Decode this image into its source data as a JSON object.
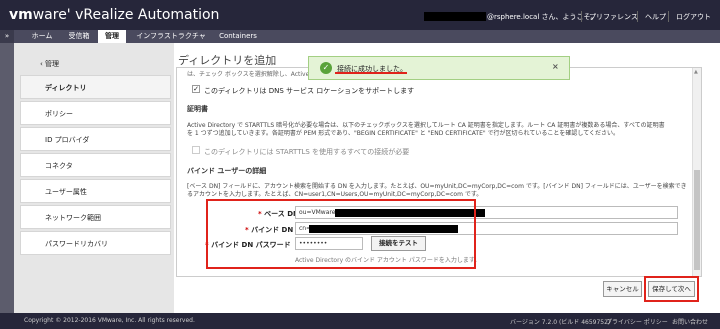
{
  "header": {
    "logo_brand": "vm",
    "logo_rest": "ware' vRealize Automation",
    "user_suffix": "@rsphere.local さん、ようこそ。",
    "links": {
      "preferences": "プリファレンス",
      "help": "ヘルプ",
      "logout": "ログアウト"
    }
  },
  "nav": {
    "toggle": "»",
    "tabs": [
      "ホーム",
      "受信箱",
      "管理",
      "インフラストラクチャ",
      "Containers"
    ]
  },
  "sidebar": {
    "back": "‹ 管理",
    "items": [
      "ディレクトリ",
      "ポリシー",
      "ID プロバイダ",
      "コネクタ",
      "ユーザー属性",
      "ネットワーク範囲",
      "パスワードリカバリ"
    ]
  },
  "page": {
    "title": "ディレクトリを追加"
  },
  "form": {
    "cut_line": "は、チェック ボックスを選択解除し、Active D",
    "dns_checkbox": "このディレクトリは DNS サービス ロケーションをサポートします",
    "cert_heading": "証明書",
    "cert_desc_1": "Active Directory で STARTTLS 暗号化が必要な場合は、以下のチェックボックスを選択してルート CA 証明書を指定します。ルート CA 証明書が複数ある場合、すべての証明書",
    "cert_desc_2": "を 1 つずつ追加していきます。各証明書が PEM 形式であり、\"BEGIN CERTIFICATE\" と \"END CERTIFICATE\" で行が区切られていることを確認してください。",
    "starttls_checkbox": "このディレクトリには STARTTLS を使用するすべての接続が必要",
    "bind_heading": "バインド ユーザーの詳細",
    "bind_desc_1": "[ベース DN] フィールドに、アカウント検索を開始する DN を入力します。たとえば、OU=myUnit,DC=myCorp,DC=com です。[バインド DN] フィールドには、ユーザーを検索でき",
    "bind_desc_2": "るアカウントを入力します。たとえば、CN=user1,CN=Users,OU=myUnit,DC=myCorp,DC=com です。",
    "base_dn_label": "ベース DN",
    "base_dn_value": "ou=VMware,",
    "bind_dn_label": "バインド DN",
    "bind_dn_value": "cn=",
    "bind_pw_label": "バインド DN パスワード",
    "bind_pw_value": "••••••••",
    "test_button": "接続をテスト",
    "hint": "Active Directory のバインド アカウント パスワードを入力します。"
  },
  "toast": {
    "message": "接続に成功しました。",
    "close": "×",
    "icon": "check-circle-icon"
  },
  "buttons": {
    "cancel": "キャンセル",
    "save_next": "保存して次へ"
  },
  "footer": {
    "copyright": "Copyright © 2012-2016 VMware, Inc. All rights reserved.",
    "version": "バージョン 7.2.0 (ビルド 4659752)",
    "privacy": "プライバシー ポリシー",
    "contact": "お問い合わせ"
  },
  "colors": {
    "header_bg": "#26263a",
    "nav_bg": "#4a4a5e",
    "highlight_red": "#e0231b",
    "toast_bg": "#e4f3d6",
    "toast_icon": "#5aa33a"
  }
}
